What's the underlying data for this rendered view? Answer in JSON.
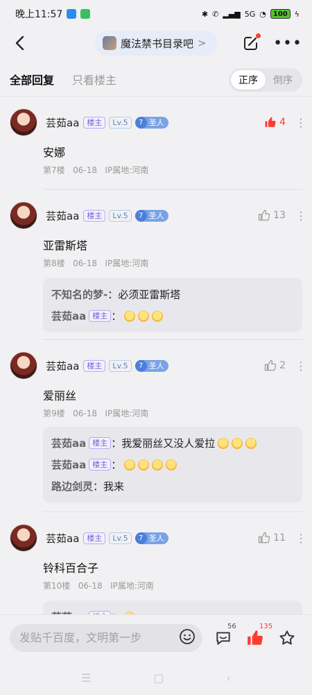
{
  "status_bar": {
    "time": "晚上11:57",
    "battery": "100",
    "network": "5G"
  },
  "nav": {
    "forum_name": "魔法禁书目录吧",
    "chevron": ">"
  },
  "filter": {
    "tab_all": "全部回复",
    "tab_owner": "只看楼主",
    "sort_asc": "正序",
    "sort_desc": "倒序"
  },
  "posts": [
    {
      "username": "芸茹aa",
      "owner_badge": "楼主",
      "level": "Lv.5",
      "title_num": "7",
      "title": "圣人",
      "likes": "4",
      "liked": true,
      "content": "安娜",
      "floor": "第7楼",
      "date": "06-18",
      "ip": "IP属地:河南",
      "replies": []
    },
    {
      "username": "芸茹aa",
      "owner_badge": "楼主",
      "level": "Lv.5",
      "title_num": "7",
      "title": "圣人",
      "likes": "13",
      "liked": false,
      "content": "亚雷斯塔",
      "floor": "第8楼",
      "date": "06-18",
      "ip": "IP属地:河南",
      "replies": [
        {
          "user": "不知名的梦-",
          "badge": "",
          "text": "必须亚雷斯塔",
          "emojis": 0
        },
        {
          "user": "芸茹aa",
          "badge": "楼主",
          "text": "",
          "emojis": 3
        }
      ]
    },
    {
      "username": "芸茹aa",
      "owner_badge": "楼主",
      "level": "Lv.5",
      "title_num": "7",
      "title": "圣人",
      "likes": "2",
      "liked": false,
      "content": "爱丽丝",
      "floor": "第9楼",
      "date": "06-18",
      "ip": "IP属地:河南",
      "replies": [
        {
          "user": "芸茹aa",
          "badge": "楼主",
          "text": "我爱丽丝又没人爱拉",
          "emojis": 3
        },
        {
          "user": "芸茹aa",
          "badge": "楼主",
          "text": "",
          "emojis": 4
        },
        {
          "user": "路边剑灵",
          "badge": "",
          "text": "我来",
          "emojis": 0
        }
      ]
    },
    {
      "username": "芸茹aa",
      "owner_badge": "楼主",
      "level": "Lv.5",
      "title_num": "7",
      "title": "圣人",
      "likes": "11",
      "liked": false,
      "content": "铃科百合子",
      "floor": "第10楼",
      "date": "06-18",
      "ip": "IP属地:河南",
      "replies": [
        {
          "user": "芸茹aa",
          "badge": "楼主",
          "text": "",
          "emojis": 1
        }
      ]
    }
  ],
  "bottom_bar": {
    "input_placeholder": "发贴千百度，文明第一步",
    "comment_count": "56",
    "like_count": "135"
  },
  "colors": {
    "accent_red": "#ff3b30",
    "owner_purple": "#7561d6",
    "level_blue": "#5b82c4"
  }
}
